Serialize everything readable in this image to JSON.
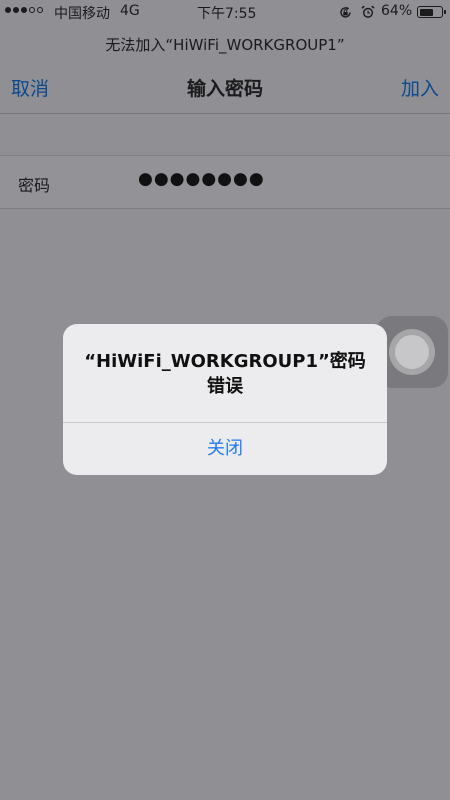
{
  "status_bar": {
    "carrier": "中国移动",
    "network": "4G",
    "time": "下午7:55",
    "battery_percent": "64%",
    "battery_level": 0.64,
    "signal_strength": 3,
    "signal_max": 5
  },
  "nav": {
    "prompt": "无法加入“HiWiFi_WORKGROUP1”",
    "title": "输入密码",
    "cancel_label": "取消",
    "join_label": "加入"
  },
  "password": {
    "label": "密码",
    "value": "●●●●●●●●"
  },
  "alert": {
    "title_line1": "“HiWiFi_WORKGROUP1”密码",
    "title_line2": "错误",
    "close_label": "关闭"
  },
  "colors": {
    "accent": "#1f7cf5",
    "nav_link": "#0c4a8e",
    "dim_background": "#8f8f94"
  }
}
